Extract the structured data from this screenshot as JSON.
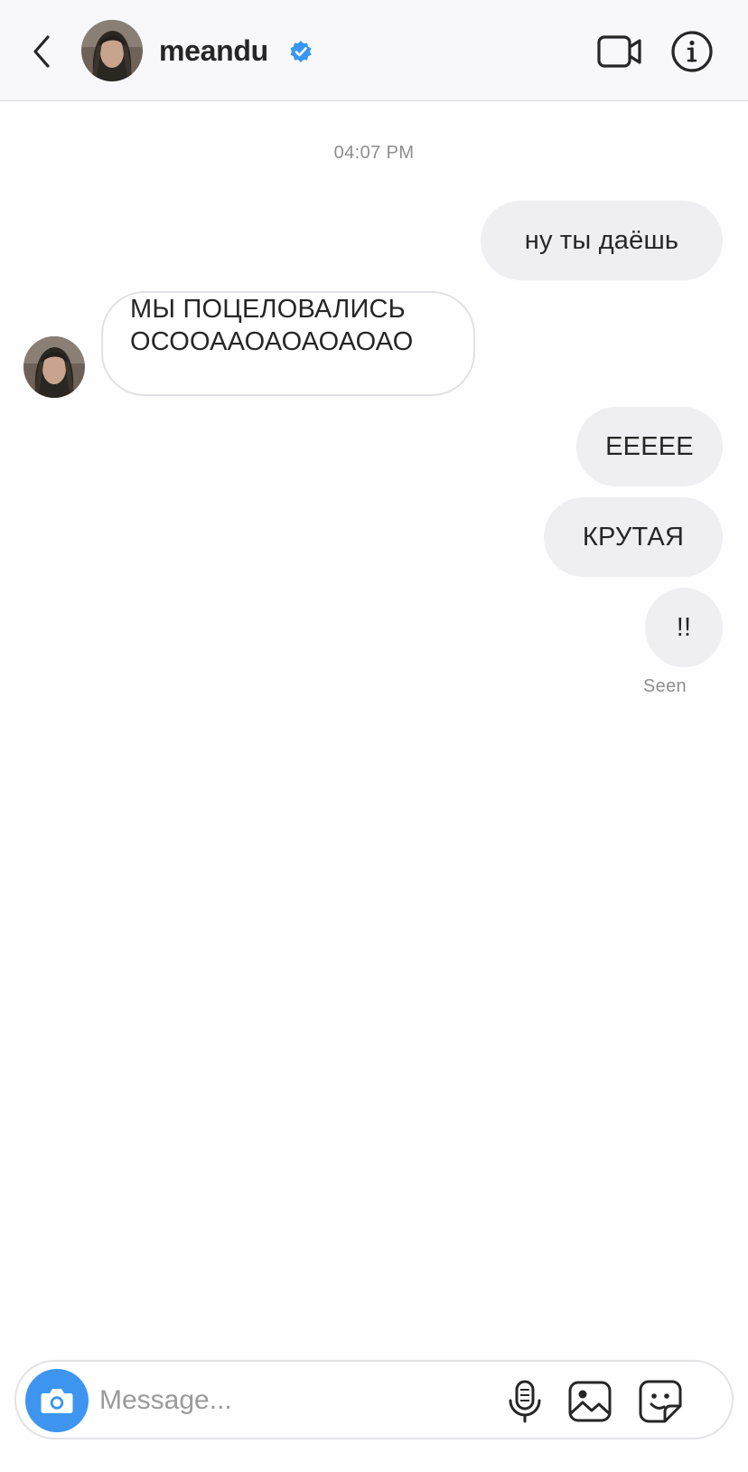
{
  "header": {
    "username": "meandu",
    "verified": true,
    "back_icon": "chevron-left-icon",
    "video_icon": "video-camera-icon",
    "info_icon": "info-icon"
  },
  "conversation": {
    "timestamp": "04:07 PM",
    "messages": [
      {
        "direction": "outgoing",
        "text": "ну ты даёшь"
      },
      {
        "direction": "incoming",
        "line1": "МЫ ПОЦЕЛОВАЛИСЬ",
        "line2": "ОСООААОАОАОАОАО"
      },
      {
        "direction": "outgoing",
        "text": "ЕЕЕЕЕ"
      },
      {
        "direction": "outgoing",
        "text": "КРУТАЯ"
      },
      {
        "direction": "outgoing",
        "text": "!!"
      }
    ],
    "status": "Seen"
  },
  "composer": {
    "placeholder": "Message...",
    "camera_icon": "camera-icon",
    "mic_icon": "microphone-icon",
    "gallery_icon": "image-gallery-icon",
    "sticker_icon": "sticker-icon"
  },
  "colors": {
    "accent": "#3d95ef",
    "verified_badge": "#3897f0",
    "outgoing_bubble": "#efeff2",
    "text": "#262626",
    "muted": "#8e8e8e"
  }
}
